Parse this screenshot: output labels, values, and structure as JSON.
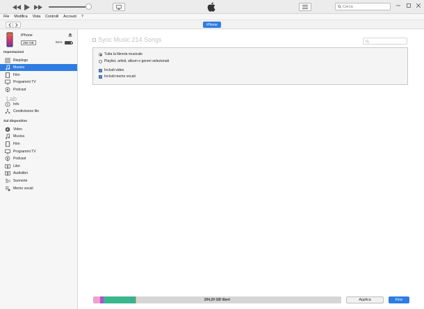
{
  "toolbar": {
    "volume_level": 0.92,
    "search_placeholder": "Cerca"
  },
  "menu": [
    "File",
    "Modifica",
    "Vista",
    "Controlli",
    "Account",
    "?"
  ],
  "device_pill": "iPhone",
  "device": {
    "name": "iPhone",
    "capacity": "256 GB",
    "battery": "91%",
    "battery_level": 0.91
  },
  "sections": {
    "settings": "Impostazioni",
    "on_device": "Sul dispositivo"
  },
  "settings_items": [
    {
      "label": "Riepilogo",
      "icon": "summary-icon"
    },
    {
      "label": "Musica",
      "icon": "music-note-icon"
    },
    {
      "label": "Film",
      "icon": "film-icon"
    },
    {
      "label": "Programmi TV",
      "icon": "tv-icon"
    },
    {
      "label": "Podcast",
      "icon": "podcast-icon"
    },
    {
      "label": "Info",
      "icon": "info-icon"
    },
    {
      "label": "Condivisione file",
      "icon": "file-sharing-icon"
    }
  ],
  "watermark": "Lab",
  "device_items": [
    {
      "label": "Video",
      "icon": "video-icon"
    },
    {
      "label": "Musica",
      "icon": "music-note-icon"
    },
    {
      "label": "Film",
      "icon": "film-icon"
    },
    {
      "label": "Programmi TV",
      "icon": "tv-icon"
    },
    {
      "label": "Podcast",
      "icon": "podcast-icon"
    },
    {
      "label": "Libri",
      "icon": "books-icon"
    },
    {
      "label": "Audiolibri",
      "icon": "audiobooks-icon"
    },
    {
      "label": "Suonerie",
      "icon": "ringtones-icon"
    },
    {
      "label": "Memo vocali",
      "icon": "voice-memos-icon"
    }
  ],
  "main": {
    "sync_title": "Sync Music 214 Songs",
    "options": {
      "all_library": "Tutta la libreria musicale",
      "selected": "Playlist, artisti, album e generi selezionati",
      "include_video": "Includi video",
      "include_memos": "Includi memo vocali"
    }
  },
  "footer": {
    "free_space": "204,20 GB liberi",
    "apply": "Applica",
    "done": "Fine"
  },
  "colors": {
    "accent": "#2e7de1",
    "cap_segments": [
      "#f0a3c9",
      "#b24fd6",
      "#3ab88d",
      "#3aaf9a",
      "#e2a936",
      "#d6d6d6"
    ]
  }
}
